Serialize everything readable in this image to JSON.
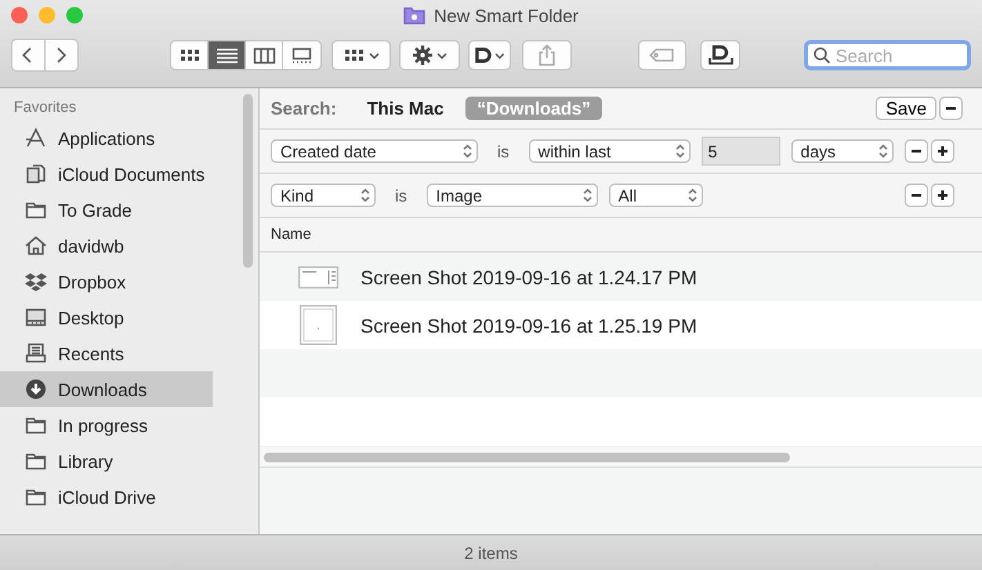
{
  "window": {
    "title": "New Smart Folder"
  },
  "toolbar": {
    "view_modes": [
      {
        "kind": "icons",
        "selected": false
      },
      {
        "kind": "list",
        "selected": true
      },
      {
        "kind": "columns",
        "selected": false
      },
      {
        "kind": "gallery",
        "selected": false
      }
    ],
    "search": {
      "placeholder": "Search"
    }
  },
  "sidebar": {
    "section": "Favorites",
    "items": [
      {
        "label": "Applications",
        "kind": "apps",
        "selected": false
      },
      {
        "label": "iCloud Documents",
        "kind": "docs",
        "selected": false
      },
      {
        "label": "To Grade",
        "kind": "folder",
        "selected": false
      },
      {
        "label": "davidwb",
        "kind": "home",
        "selected": false
      },
      {
        "label": "Dropbox",
        "kind": "dropbox",
        "selected": false
      },
      {
        "label": "Desktop",
        "kind": "desktop",
        "selected": false
      },
      {
        "label": "Recents",
        "kind": "recents",
        "selected": false
      },
      {
        "label": "Downloads",
        "kind": "downloads",
        "selected": true
      },
      {
        "label": "In progress",
        "kind": "folder",
        "selected": false
      },
      {
        "label": "Library",
        "kind": "folder",
        "selected": false
      },
      {
        "label": "iCloud Drive",
        "kind": "folder",
        "selected": false
      }
    ]
  },
  "search_bar": {
    "label": "Search:",
    "scopes": [
      {
        "label": "This Mac",
        "selected": false
      },
      {
        "label": "“Downloads”",
        "selected": true
      }
    ],
    "save": "Save"
  },
  "criteria": [
    {
      "controls": [
        {
          "kind": "popup",
          "text": "Created date"
        },
        {
          "kind": "text",
          "text": "is"
        },
        {
          "kind": "popup",
          "text": "within last"
        },
        {
          "kind": "field",
          "text": "5"
        },
        {
          "kind": "popup",
          "text": "days"
        }
      ]
    },
    {
      "controls": [
        {
          "kind": "popup",
          "text": "Kind"
        },
        {
          "kind": "text",
          "text": "is"
        },
        {
          "kind": "popup",
          "text": "Image"
        },
        {
          "kind": "popup",
          "text": "All"
        }
      ]
    }
  ],
  "file_list": {
    "columns": [
      "Name"
    ],
    "rows": [
      {
        "name": "Screen Shot 2019-09-16 at 1.24.17 PM",
        "kind": "wide"
      },
      {
        "name": "Screen Shot 2019-09-16 at 1.25.19 PM",
        "kind": "tall"
      }
    ]
  },
  "status_bar": {
    "text": "2 items"
  }
}
